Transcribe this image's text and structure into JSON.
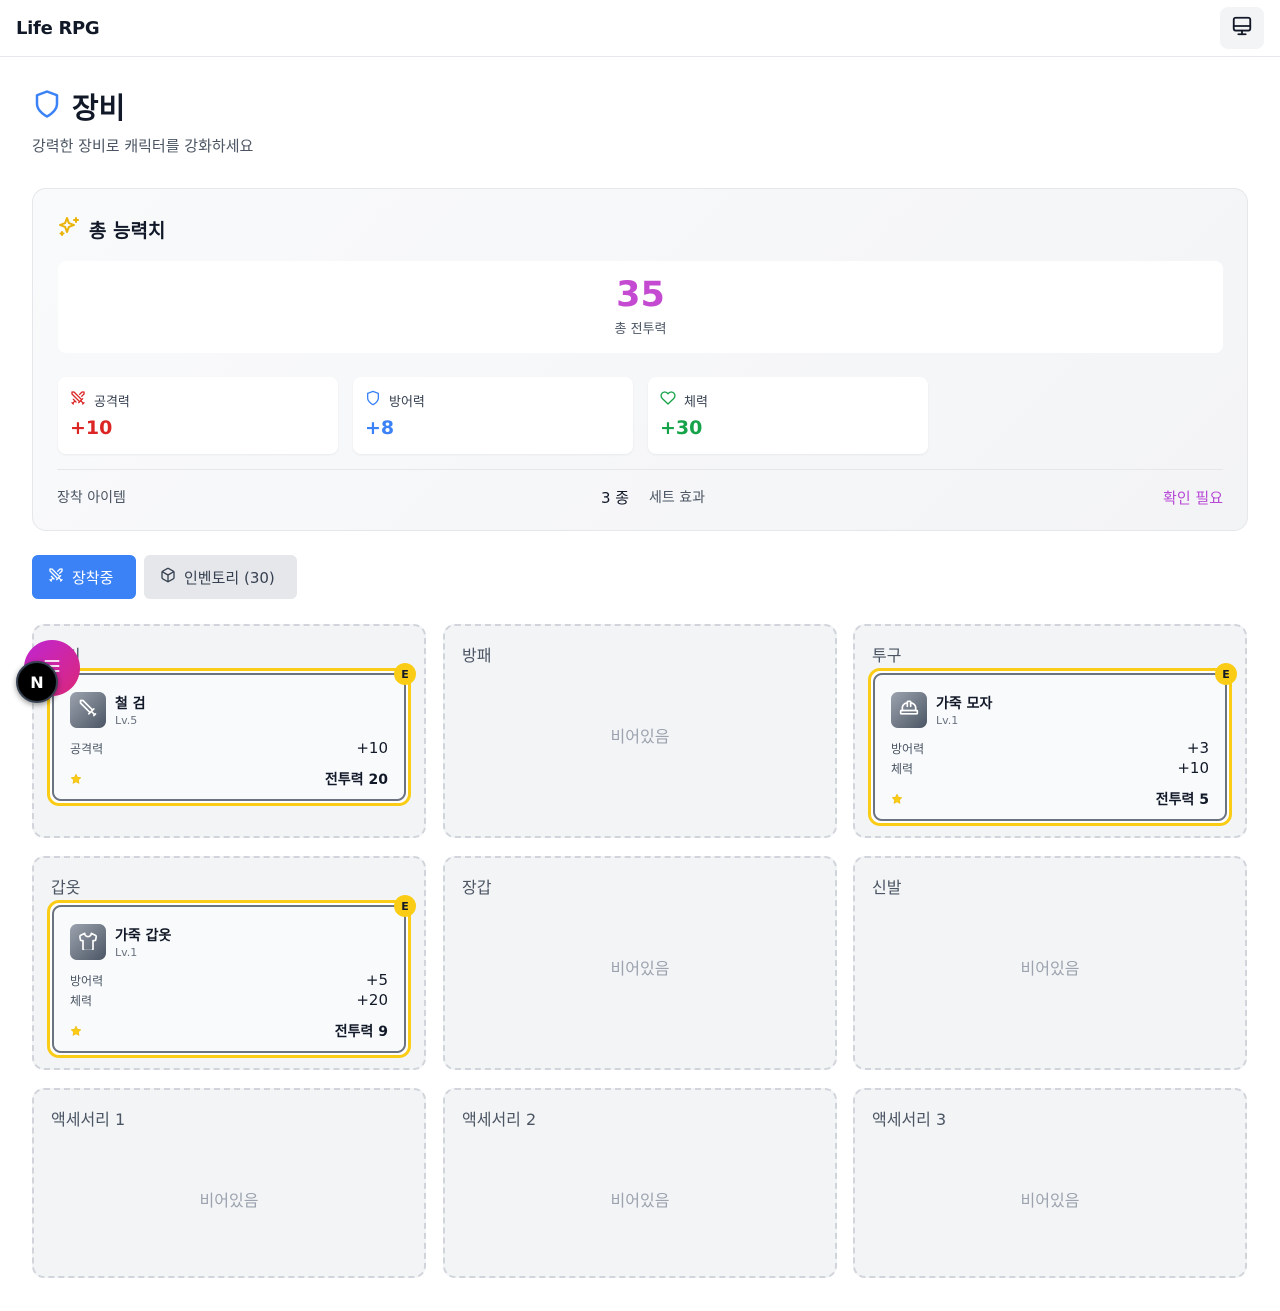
{
  "app": {
    "title": "Life RPG"
  },
  "page": {
    "title": "장비",
    "subtitle": "강력한 장비로 캐릭터를 강화하세요"
  },
  "stats": {
    "title": "총 능력치",
    "total_power": "35",
    "total_power_label": "총 전투력",
    "attack": {
      "label": "공격력",
      "value": "+10",
      "color": "#dc2626"
    },
    "defense": {
      "label": "방어력",
      "value": "+8",
      "color": "#3b82f6"
    },
    "hp": {
      "label": "체력",
      "value": "+30",
      "color": "#16a34a"
    },
    "equipped_label": "장착 아이템",
    "equipped_count": "3 종",
    "set_label": "세트 효과",
    "set_action": "확인 필요"
  },
  "tabs": {
    "equipped": "장착중",
    "inventory": "인벤토리 (30)"
  },
  "slots": {
    "weapon": {
      "label": "무기",
      "item": {
        "badge": "E",
        "name": "철 검",
        "level": "Lv.5",
        "stats": [
          {
            "label": "공격력",
            "value": "+10"
          }
        ],
        "power": "전투력 20"
      }
    },
    "shield": {
      "label": "방패",
      "empty": "비어있음"
    },
    "helmet": {
      "label": "투구",
      "item": {
        "badge": "E",
        "name": "가죽 모자",
        "level": "Lv.1",
        "stats": [
          {
            "label": "방어력",
            "value": "+3"
          },
          {
            "label": "체력",
            "value": "+10"
          }
        ],
        "power": "전투력 5"
      }
    },
    "armor": {
      "label": "갑옷",
      "item": {
        "badge": "E",
        "name": "가죽 갑옷",
        "level": "Lv.1",
        "stats": [
          {
            "label": "방어력",
            "value": "+5"
          },
          {
            "label": "체력",
            "value": "+20"
          }
        ],
        "power": "전투력 9"
      }
    },
    "gloves": {
      "label": "장갑",
      "empty": "비어있음"
    },
    "boots": {
      "label": "신발",
      "empty": "비어있음"
    },
    "accessory1": {
      "label": "액세서리 1",
      "empty": "비어있음"
    },
    "accessory2": {
      "label": "액세서리 2",
      "empty": "비어있음"
    },
    "accessory3": {
      "label": "액세서리 3",
      "empty": "비어있음"
    }
  },
  "overlay": {
    "dev_badge": "N"
  },
  "icons": [
    "monitor-icon",
    "shield-icon",
    "sparkles-icon",
    "swords-icon",
    "heart-icon",
    "box-icon",
    "sword-icon",
    "hard-hat-icon",
    "shirt-icon",
    "star-icon",
    "menu-icon"
  ]
}
